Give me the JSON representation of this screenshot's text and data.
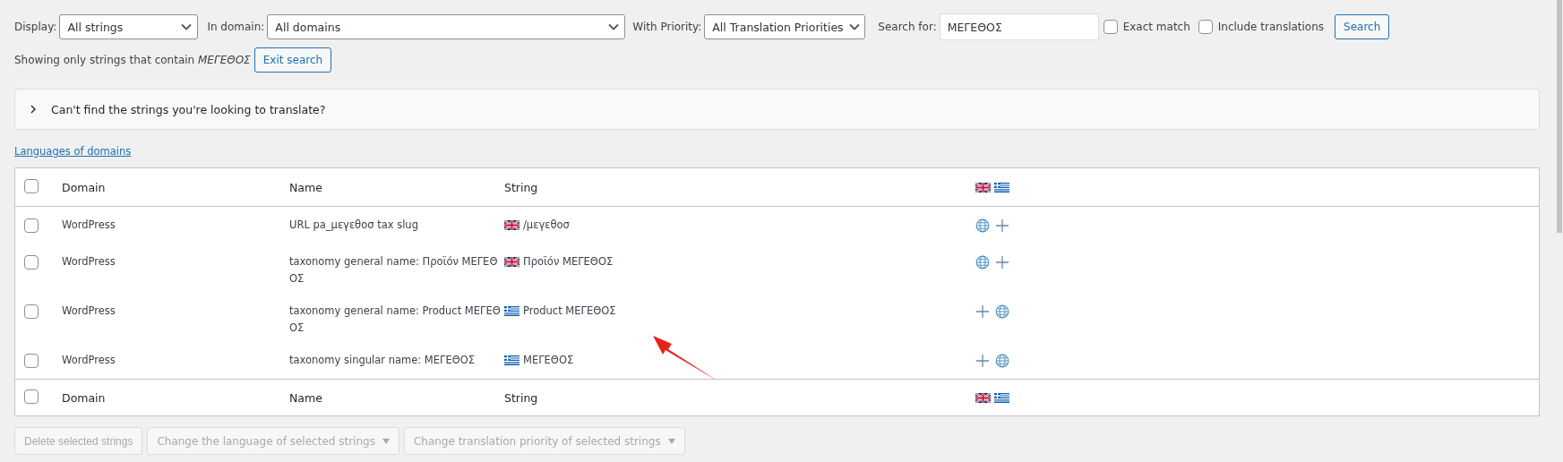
{
  "filters": {
    "display": {
      "label": "Display:",
      "value": "All strings"
    },
    "domain": {
      "label": "In domain:",
      "value": "All domains"
    },
    "priority": {
      "label": "With Priority:",
      "value": "All Translation Priorities"
    },
    "search": {
      "label": "Search for:",
      "value": "ΜΕΓΕΘΟΣ"
    },
    "exact_match": {
      "label": "Exact match",
      "checked": false
    },
    "include_translations": {
      "label": "Include translations",
      "checked": false
    },
    "search_button": "Search"
  },
  "search_notice": {
    "text": "Showing only strings that contain *ΜΕΓΕΘΟΣ*",
    "button": "Exit search"
  },
  "help_panel": {
    "text": "Can't find the strings you're looking to translate?",
    "expanded": false
  },
  "languages_link": "Languages of domains",
  "table": {
    "columns": [
      "Domain",
      "Name",
      "String"
    ],
    "header_checked": false,
    "language_flags": [
      {
        "kind": "uk"
      },
      {
        "kind": "greece"
      }
    ],
    "rows": [
      {
        "checked": false,
        "domain": "WordPress",
        "name": "URL pa_μεγεθοσ tax slug",
        "flag": {
          "kind": "uk"
        },
        "string": "/μεγεθοσ",
        "translations": [
          {
            "kind": "globe"
          },
          {
            "kind": "plus"
          }
        ]
      },
      {
        "checked": false,
        "domain": "WordPress",
        "name": "taxonomy general name: Προϊόν ΜΕΓΕΘΟΣ",
        "flag": {
          "kind": "uk"
        },
        "string": "Προϊόν ΜΕΓΕΘΟΣ",
        "translations": [
          {
            "kind": "globe"
          },
          {
            "kind": "plus"
          }
        ]
      },
      {
        "checked": false,
        "domain": "WordPress",
        "name": "taxonomy general name: Product ΜΕΓΕΘΟΣ",
        "flag": {
          "kind": "greece"
        },
        "string": "Product ΜΕΓΕΘΟΣ",
        "translations": [
          {
            "kind": "plus"
          },
          {
            "kind": "globe"
          }
        ]
      },
      {
        "checked": false,
        "domain": "WordPress",
        "name": "taxonomy singular name: ΜΕΓΕΘΟΣ",
        "flag": {
          "kind": "greece"
        },
        "string": "ΜΕΓΕΘΟΣ",
        "translations": [
          {
            "kind": "plus"
          },
          {
            "kind": "globe"
          }
        ]
      }
    ],
    "footer_checked": false,
    "footer_columns": [
      "Domain",
      "Name",
      "String"
    ],
    "footer_language_flags": [
      {
        "kind": "uk"
      },
      {
        "kind": "greece"
      }
    ]
  },
  "bulk_actions": [
    {
      "kind": "button",
      "label": "Delete selected strings",
      "disabled": true
    },
    {
      "kind": "dropdown",
      "label": "Change the language of selected strings",
      "disabled": true
    },
    {
      "kind": "dropdown",
      "label": "Change translation priority of selected strings",
      "disabled": true
    }
  ]
}
